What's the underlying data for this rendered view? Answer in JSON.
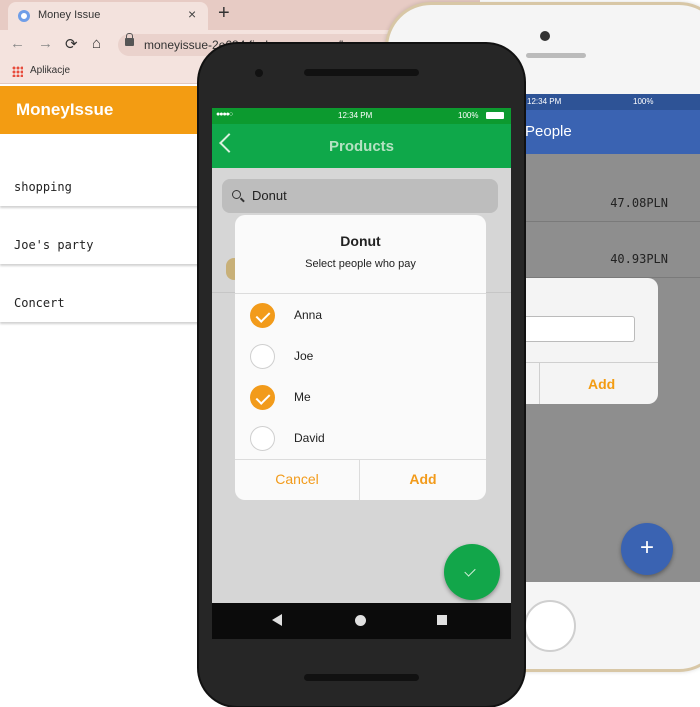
{
  "browser": {
    "tab_title": "Money Issue",
    "tab_close": "×",
    "new_tab": "+",
    "url": "moneyissue-2e684.firebaseapp.com/home",
    "bookmarks_label": "Aplikacje",
    "nav": {
      "back": "←",
      "forward": "→",
      "reload": "⟳",
      "home": "⌂"
    }
  },
  "web_app": {
    "title": "MoneyIssue",
    "events": [
      {
        "label": "shopping"
      },
      {
        "label": "Joe's party"
      },
      {
        "label": "Concert"
      }
    ]
  },
  "iphone_app": {
    "time": "12:34 PM",
    "battery": "100%",
    "title": "People",
    "amounts": [
      "47.08PLN",
      "40.93PLN"
    ],
    "dialog_add": "Add",
    "fab": "+"
  },
  "android_app": {
    "signal": "●●●●○",
    "time": "12:34 PM",
    "battery": "100%",
    "title": "Products",
    "search_value": "Donut",
    "dialog": {
      "title": "Donut",
      "subtitle": "Select people who pay",
      "options": [
        {
          "label": "Anna",
          "checked": true
        },
        {
          "label": "Joe",
          "checked": false
        },
        {
          "label": "Me",
          "checked": true
        },
        {
          "label": "David",
          "checked": false
        }
      ],
      "cancel": "Cancel",
      "add": "Add"
    }
  },
  "colors": {
    "orange_accent": "#f39c12",
    "android_green": "#0fa84a",
    "ios_blue": "#3a63b2"
  }
}
